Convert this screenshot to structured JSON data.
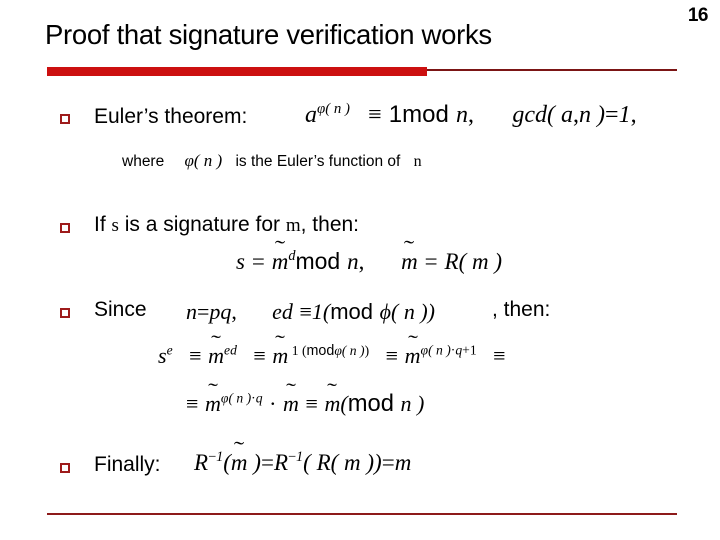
{
  "slide": {
    "page_number": "16",
    "title": "Proof that signature verification works",
    "accent_color": "#cc1010",
    "rule_color": "#8d1a1a",
    "bullet_color": "#9e1b1b",
    "background": "#ffffff"
  },
  "bullets": [
    {
      "id": "euler-theorem",
      "label": "Euler’s theorem:",
      "formula": "a^φ(n) ≡ 1 mod n,   gcd(a, n) = 1,",
      "sub_parts": {
        "where": "where",
        "phi": "φ( n )",
        "rest": "is the Euler’s function of",
        "n": "n"
      }
    },
    {
      "id": "signature-def",
      "label_pre": "If",
      "label_s": "s",
      "label_mid": "is a signature for",
      "label_m": "m",
      "label_post": ", then:",
      "formula": "s = m̃^d mod n,   m̃ = R( m )"
    },
    {
      "id": "since",
      "label": "Since",
      "formula_inline": "n = pq,   ed ≡ 1(mod ϕ( n ))",
      "label_post": ", then:",
      "formula_line1": "s^e ≡ m̃^ed ≡ m̃^1(mod φ( n )) ≡ m̃^φ( n )·q+1 ≡",
      "formula_line2": "≡ m̃^φ( n )·q · m̃ ≡ m̃(mod n )"
    },
    {
      "id": "finally",
      "label": "Finally:",
      "formula": "R⁻¹( m̃ ) = R⁻¹( R( m )) = m"
    }
  ],
  "glyphs": {
    "equiv": "≡",
    "phi_script": "φ",
    "phi_var": "ϕ",
    "tilde": "~",
    "middot": "·",
    "minus": "−"
  }
}
